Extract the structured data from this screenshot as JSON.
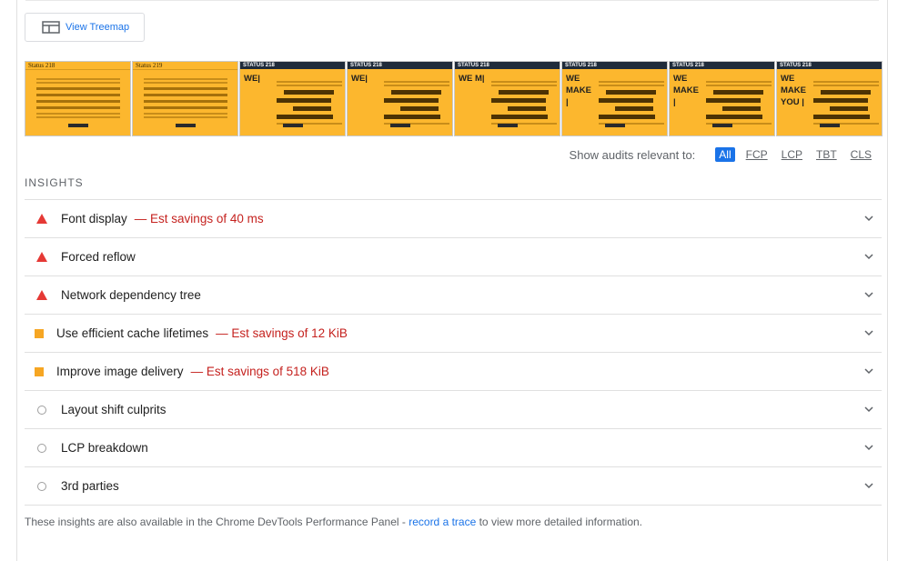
{
  "toolbar": {
    "treemap_label": "View Treemap"
  },
  "filmstrip": {
    "frames": [
      {
        "brand": "Status 218",
        "headline": "",
        "style": "serif"
      },
      {
        "brand": "Status 219",
        "headline": "",
        "style": "serif"
      },
      {
        "brand": "STATUS 218",
        "headline": "WE|",
        "style": "dark"
      },
      {
        "brand": "STATUS 218",
        "headline": "WE|",
        "style": "dark"
      },
      {
        "brand": "STATUS 218",
        "headline": "WE M|",
        "style": "dark"
      },
      {
        "brand": "STATUS 218",
        "headline": "WE MAKE |",
        "style": "dark"
      },
      {
        "brand": "STATUS 218",
        "headline": "WE MAKE |",
        "style": "dark"
      },
      {
        "brand": "STATUS 218",
        "headline": "WE MAKE YOU |",
        "style": "dark"
      }
    ]
  },
  "audit_filter": {
    "label": "Show audits relevant to:",
    "chips": [
      "All",
      "FCP",
      "LCP",
      "TBT",
      "CLS"
    ],
    "active": "All"
  },
  "insights": {
    "section_title": "INSIGHTS",
    "rows": [
      {
        "title": "Font display",
        "savings": "— Est savings of 40 ms",
        "severity": "fail"
      },
      {
        "title": "Forced reflow",
        "savings": "",
        "severity": "fail"
      },
      {
        "title": "Network dependency tree",
        "savings": "",
        "severity": "fail"
      },
      {
        "title": "Use efficient cache lifetimes",
        "savings": "— Est savings of 12 KiB",
        "severity": "average"
      },
      {
        "title": "Improve image delivery",
        "savings": "— Est savings of 518 KiB",
        "severity": "average"
      },
      {
        "title": "Layout shift culprits",
        "savings": "",
        "severity": "informative"
      },
      {
        "title": "LCP breakdown",
        "savings": "",
        "severity": "informative"
      },
      {
        "title": "3rd parties",
        "savings": "",
        "severity": "informative"
      }
    ]
  },
  "footer": {
    "before": "These insights are also available in the Chrome DevTools Performance Panel - ",
    "link": "record a trace",
    "after": " to view more detailed information."
  },
  "colors": {
    "accent": "#1a73e8",
    "fail": "#e53935",
    "average": "#f6a623",
    "savings": "#c5221f",
    "frame_bg": "#fcb72e"
  },
  "icons": {
    "treemap": "treemap-icon",
    "fail": "warning-triangle-icon",
    "average": "average-square-icon",
    "informative": "info-circle-icon",
    "expand": "chevron-down-icon"
  }
}
